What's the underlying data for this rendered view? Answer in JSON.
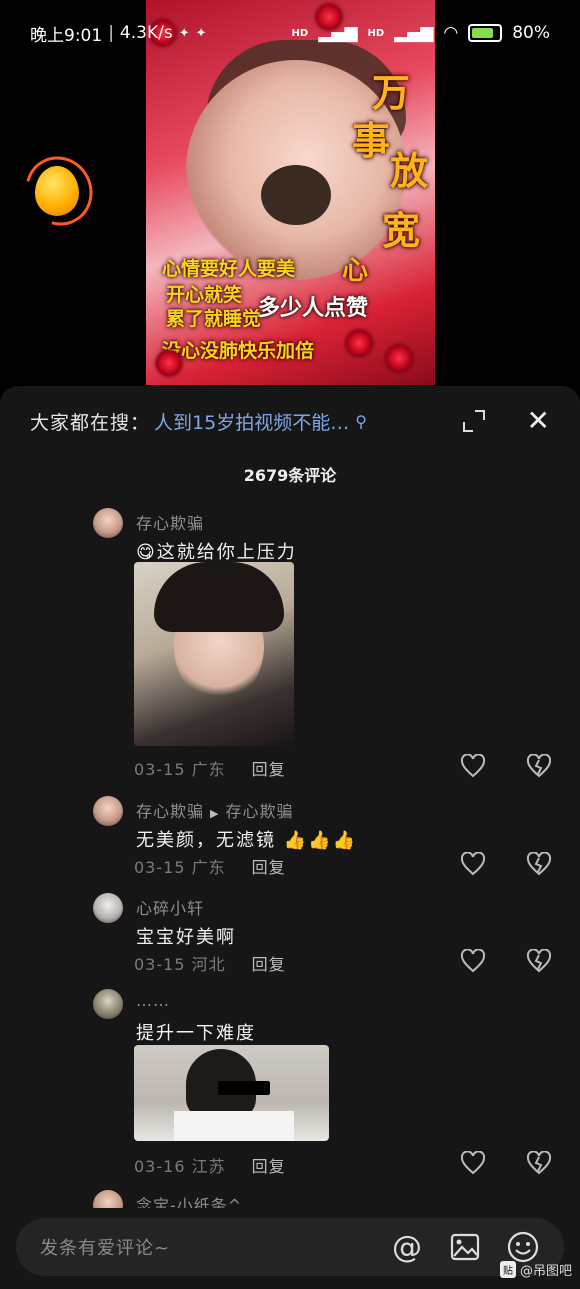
{
  "status_bar": {
    "time": "晚上9:01",
    "speed": "4.3K/s",
    "network_1": "HD",
    "network_2": "HD",
    "battery": "80%",
    "battery_level": 0.8
  },
  "video": {
    "overlay_title_chars": [
      "万",
      "事",
      "放",
      "宽",
      "心"
    ],
    "lines": [
      "心情要好人要美",
      "开心就笑",
      "累了就睡觉",
      "多少人点赞",
      "没心没肺快乐加倍"
    ]
  },
  "sheet": {
    "search_prefix": "大家都在搜：",
    "search_query": "人到15岁拍视频不能…",
    "comment_count": "2679条评论"
  },
  "comments": [
    {
      "username": "存心欺骗",
      "reply_to": "",
      "text": "😋这就给你上压力",
      "date": "03-15",
      "location": "广东",
      "reply_label": "回复",
      "has_image": true
    },
    {
      "username": "存心欺骗",
      "reply_to": "存心欺骗",
      "text": "无美颜，无滤镜 👍👍👍",
      "date": "03-15",
      "location": "广东",
      "reply_label": "回复",
      "has_image": false
    },
    {
      "username": "心碎小轩",
      "reply_to": "",
      "text": "宝宝好美啊",
      "date": "03-15",
      "location": "河北",
      "reply_label": "回复",
      "has_image": false
    },
    {
      "username": "……",
      "reply_to": "",
      "text": "提升一下难度",
      "date": "03-16",
      "location": "江苏",
      "reply_label": "回复",
      "has_image": true
    },
    {
      "username": "念宝-小纸条^",
      "reply_to": "",
      "text": "",
      "date": "",
      "location": "",
      "reply_label": "",
      "has_image": false
    }
  ],
  "input_bar": {
    "placeholder": "发条有爱评论~"
  },
  "watermark": {
    "badge": "贴",
    "text": "@吊图吧"
  },
  "colors": {
    "sheet_bg": "#161616",
    "search_link": "#7fa6e6",
    "battery_fill": "#8bdc4b",
    "egg_ring": "#ff5a1f"
  }
}
